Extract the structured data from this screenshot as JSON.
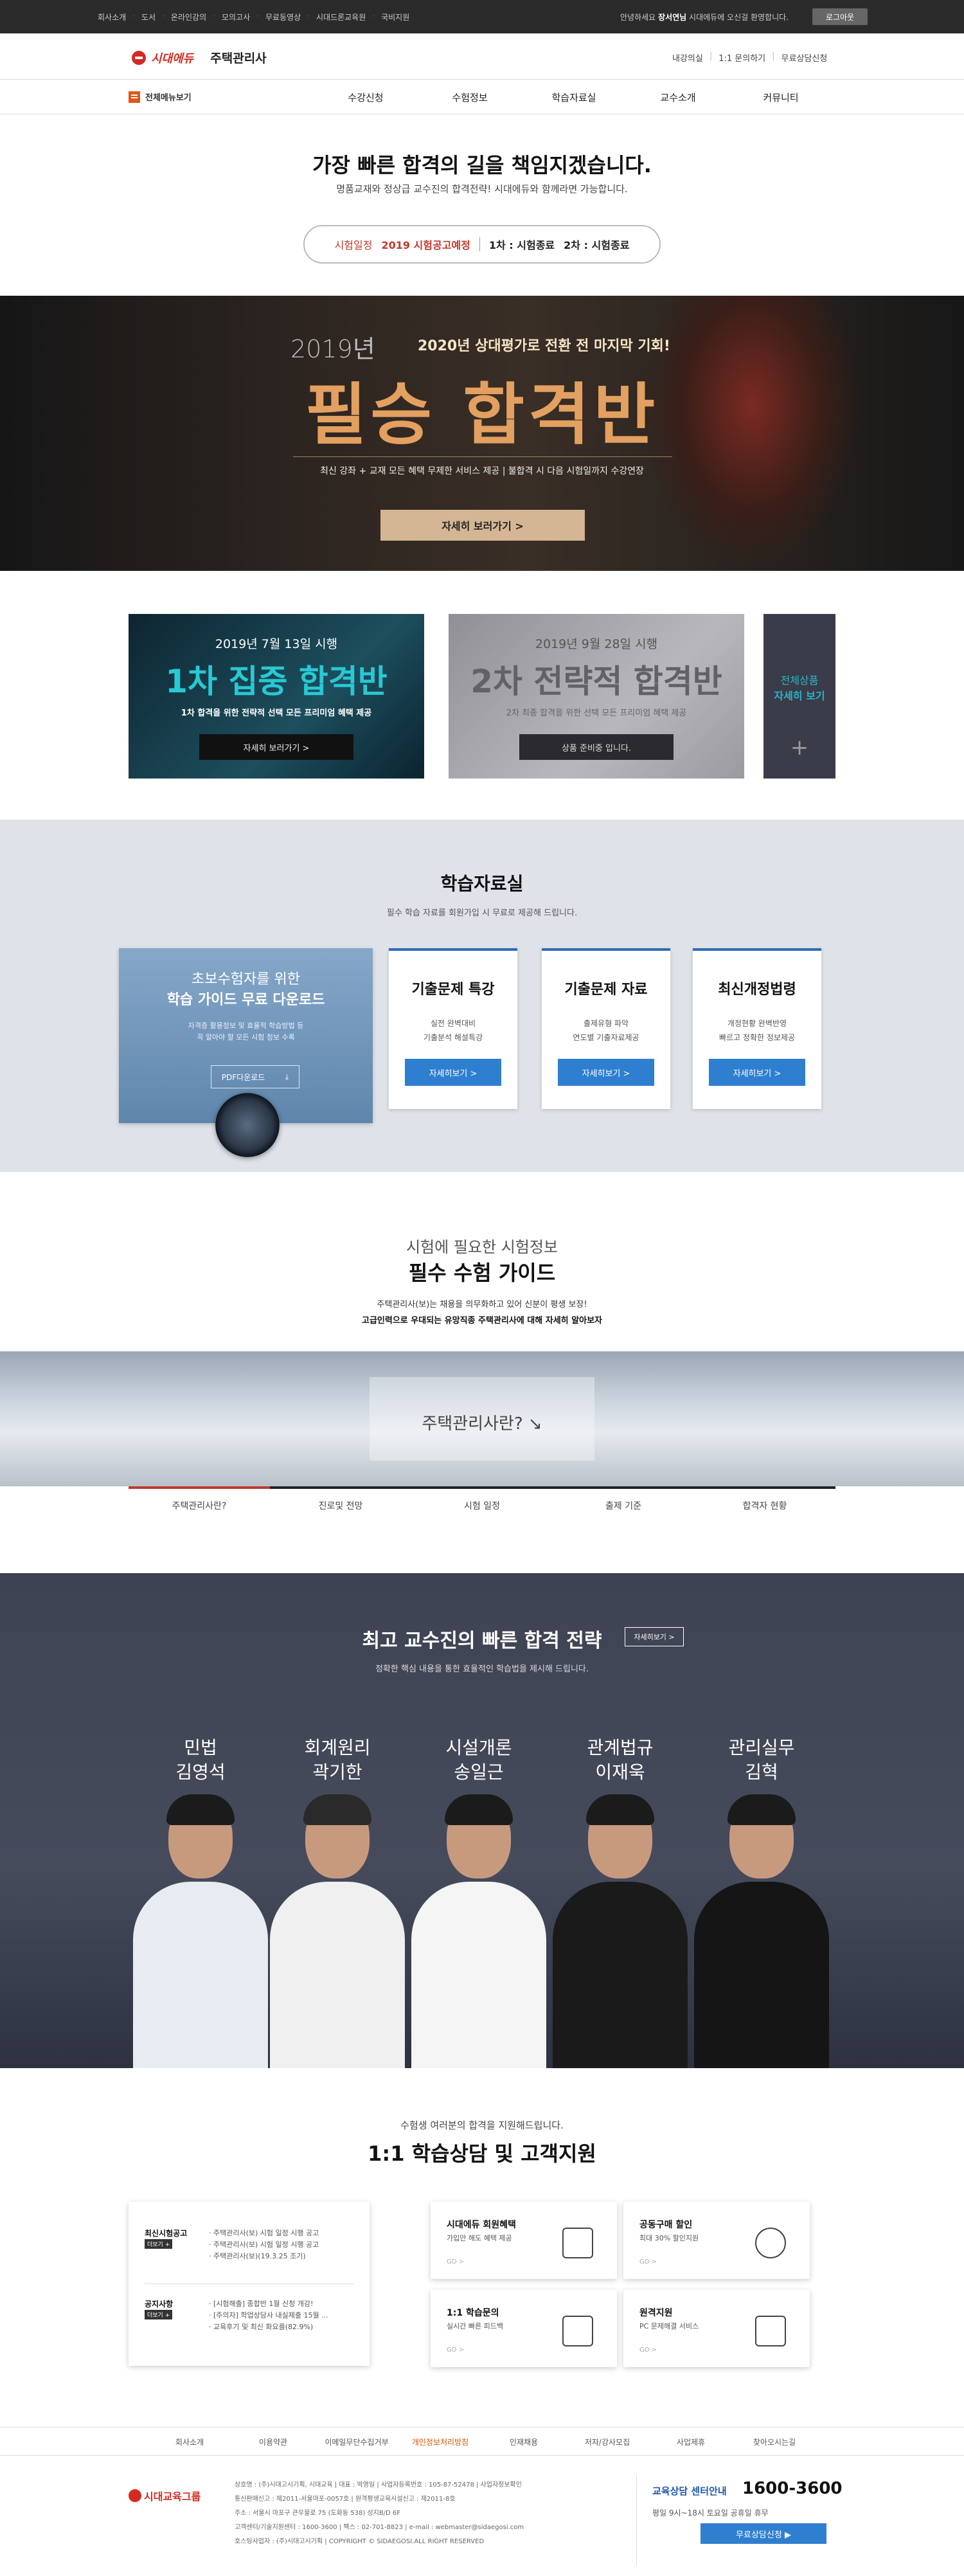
{
  "topbar": {
    "links": [
      "회사소개",
      "도서",
      "온라인강의",
      "모의고사",
      "무료동영상",
      "시대드론교육원",
      "국비지원"
    ],
    "greeting_pre": "안녕하세요",
    "user": "장서연님",
    "greeting_post": "시대에듀에 오신걸 환영합니다.",
    "logout": "로그아웃"
  },
  "header": {
    "brand": "시대에듀",
    "site": "주택관리사",
    "util": [
      "내강의실",
      "1:1 문의하기",
      "무료상담신청"
    ]
  },
  "nav": {
    "all_menu": "전체메뉴보기",
    "items": [
      "수강신청",
      "수험정보",
      "학습자료실",
      "교수소개",
      "커뮤니티"
    ]
  },
  "hero": {
    "slogan": "가장 빠른 합격의 길을 책임지겠습니다.",
    "sub": "명품교재와 정상급 교수진의 합격전략! 시대에듀와 함께라면 가능합니다.",
    "sched_label": "시험일정",
    "sched_value": "2019 시험공고예정",
    "exam1": "1차 : 시험종료",
    "exam2": "2차 : 시험종료"
  },
  "banner": {
    "year": "2019년",
    "lead": "2020년 상대평가로 전환 전 마지막 기회!",
    "title": "필승 합격반",
    "desc": "최신 강좌 + 교재 모든 혜택 무제한 서비스 제공 | 불합격 시 다음 시험일까지 수강연장",
    "button": "자세히 보러가기 >"
  },
  "promos": [
    {
      "date": "2019년 7월 13일 시행",
      "title": "1차 집중 합격반",
      "desc": "1차 합격을 위한 전략적 선택 모든 프리미엄 혜택 제공",
      "button": "자세히 보러가기 >"
    },
    {
      "date": "2019년 9월 28일 시행",
      "title": "2차 전략적 합격반",
      "desc": "2차 최종 합격을 위한 선택 모든 프리미엄 혜택 제공",
      "button": "상품 준비중 입니다."
    }
  ],
  "promo_all": {
    "line1": "전체상품",
    "line2": "자세히 보기",
    "plus": "+"
  },
  "study": {
    "heading": "학습자료실",
    "sub": "필수 학습 자료를 회원가입 시 무료로 제공해 드립니다.",
    "guide_line1": "초보수험자를 위한",
    "guide_line2": "학습 가이드 무료 다운로드",
    "guide_desc1": "자격증 활용정보 및 효율적 학습방법 등",
    "guide_desc2": "꼭 알아야 할 모든 시험 정보 수록",
    "guide_btn": "PDF다운로드",
    "cards": [
      {
        "title": "기출문제 특강",
        "d1": "실전 완벽대비",
        "d2": "기출분석 해설특강",
        "btn": "자세히보기 >"
      },
      {
        "title": "기출문제 자료",
        "d1": "출제유형 파악",
        "d2": "연도별 기출자료제공",
        "btn": "자세히보기 >"
      },
      {
        "title": "최신개정법령",
        "d1": "개정현황 완벽반영",
        "d2": "빠르고 정확한 정보제공",
        "btn": "자세히보기 >"
      }
    ]
  },
  "exam_guide": {
    "sub": "시험에 필요한 시험정보",
    "heading": "필수 수험 가이드",
    "d1": "주택관리사(보)는 채용을 의무화하고 있어 신분이 평생 보장!",
    "d2": "고급인력으로 우대되는 유망직종 주택관리사에 대해 자세히 알아보자",
    "image_caption": "주택관리사란? ↘",
    "tabs": [
      "주택관리사란?",
      "진로및 전망",
      "시험 일정",
      "출제 기준",
      "합격자 현황"
    ]
  },
  "professors": {
    "heading": "최고 교수진의 빠른 합격 전략",
    "more": "자세히보기 >",
    "sub": "정확한 핵심 내용을 통한 효율적인 학습법을 제시해 드립니다.",
    "list": [
      {
        "subject": "민법",
        "name": "김영석"
      },
      {
        "subject": "회계원리",
        "name": "곽기한"
      },
      {
        "subject": "시설개론",
        "name": "송일근"
      },
      {
        "subject": "관계법규",
        "name": "이재욱"
      },
      {
        "subject": "관리실무",
        "name": "김혁"
      }
    ]
  },
  "support": {
    "sub": "수험생 여러분의 합격을 지원해드립니다.",
    "heading": "1:1 학습상담 및 고객지원",
    "notice": {
      "label1": "최신시험공고",
      "more": "더보기 +",
      "items1": [
        "주택관리사(보) 시험 일정 시행 공고",
        "주택관리사(보) 시험 일정 시행 공고",
        "주택관리사(보)(19.3.25 조기)"
      ],
      "label2": "공지사항",
      "items2": [
        "[시험해출] 종합반 1월 신청 개강!",
        "[주의자] 학업상담사 내실제출 15월 ...",
        "교육후기 및 최신 화요를(82.9%)"
      ]
    },
    "boxes": [
      {
        "title": "시대에듀 회원혜택",
        "desc": "가입만 해도 혜택 제공",
        "go": "GO >"
      },
      {
        "title": "공동구매 할인",
        "desc": "최대 30% 할인지원",
        "go": "GO >"
      },
      {
        "title": "1:1 학습문의",
        "desc": "실시간 빠른 피드백",
        "go": "GO >"
      },
      {
        "title": "원격지원",
        "desc": "PC 문제해결 서비스",
        "go": "GO >"
      }
    ]
  },
  "footer": {
    "nav": [
      "회사소개",
      "이용약관",
      "이메일무단수집거부",
      "개인정보처리방침",
      "인재채용",
      "저자/강사모집",
      "사업제휴",
      "찾아오시는길"
    ],
    "logo": "시대교육그룹",
    "info": [
      "상호명 : (주)시대고시기획, 시대교육 | 대표 : 박영일 | 사업자등록번호 : 105-87-52478 | 사업자정보확인",
      "통신판매신고 : 제2011-서울마포-0057호 | 원격평생교육시설신고 : 제2011-8호",
      "주소 : 서울시 마포구 큰우물로 75 (도화동 538) 성지B/D 6F",
      "고객센터/기술지원센터 : 1600-3600 | 팩스 : 02-701-8823 | e-mail : webmaster@sidaegosi.com",
      "호스팅사업자 : (주)시대고시기획 | COPYRIGHT © SIDAEGOSI.ALL RIGHT RESERVED"
    ],
    "cs_title": "교육상담 센터안내",
    "cs_number": "1600-3600",
    "cs_hours": "평일 9시~18시 토요일 공휴일 휴무",
    "cs_button": "무료상담신청 ▶"
  }
}
